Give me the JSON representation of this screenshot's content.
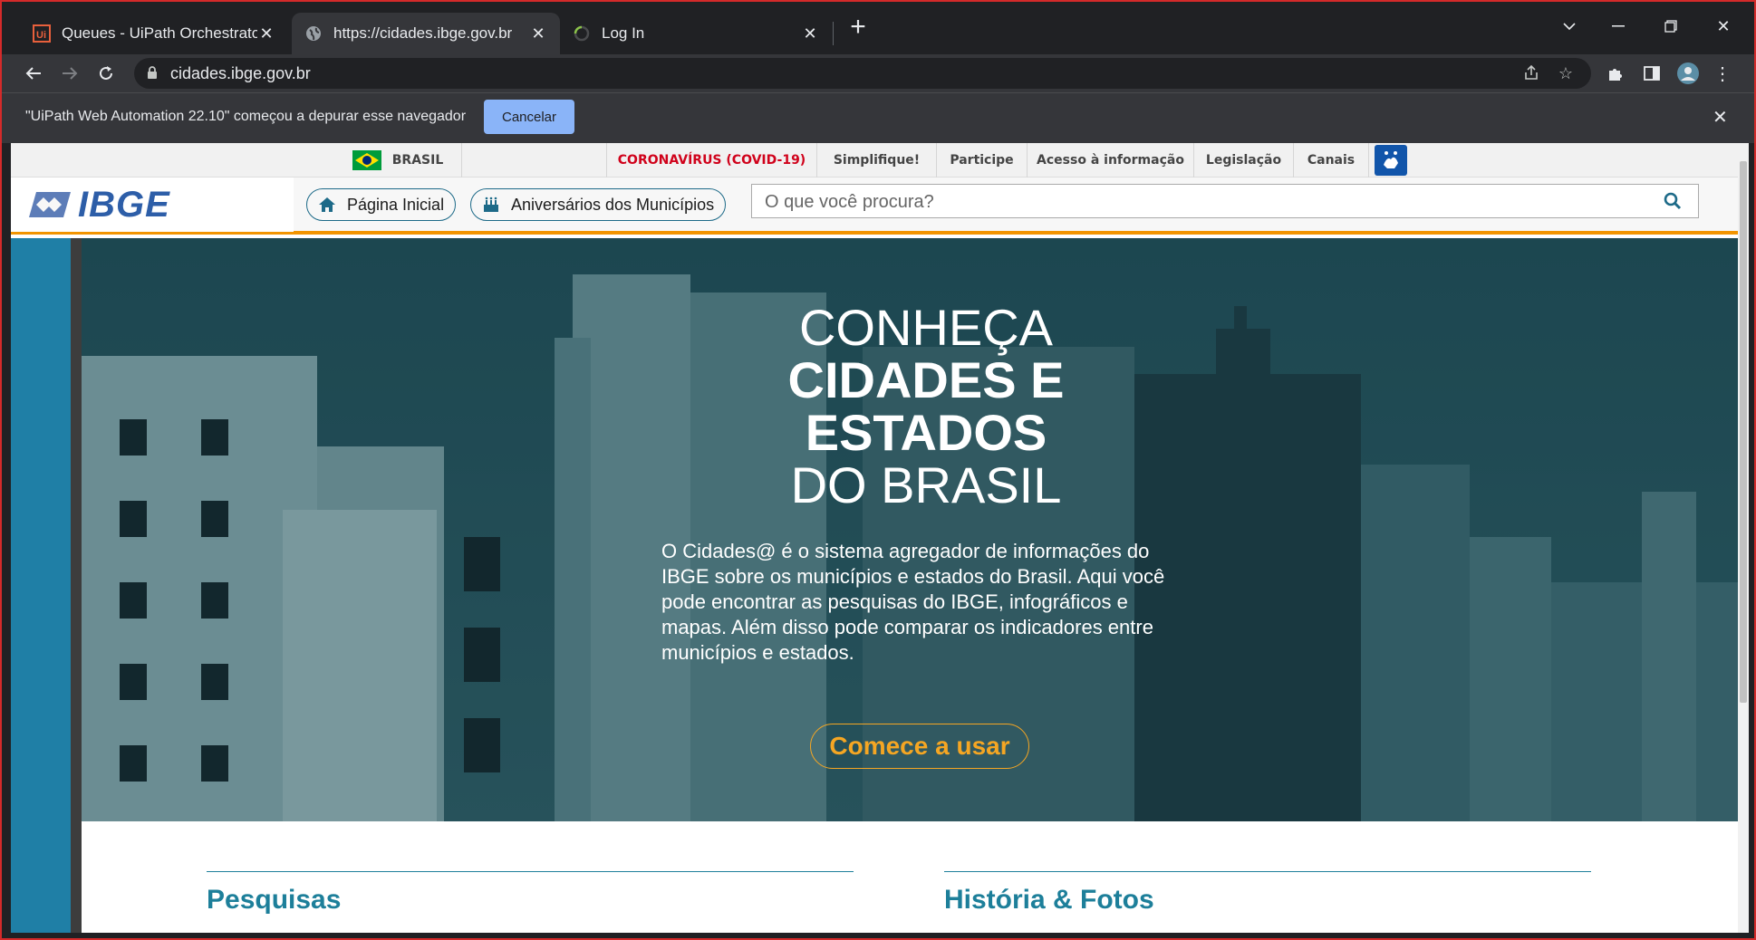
{
  "browser": {
    "tabs": [
      {
        "title": "Queues - UiPath Orchestrator",
        "icon": "uipath-icon"
      },
      {
        "title": "https://cidades.ibge.gov.br",
        "icon": "globe-icon"
      },
      {
        "title": "Log In",
        "icon": "loading-icon"
      }
    ],
    "url": "cidades.ibge.gov.br",
    "infobar": {
      "message": "\"UiPath Web Automation 22.10\" começou a depurar esse navegador",
      "cancel_label": "Cancelar"
    }
  },
  "govbar": {
    "country": "BRASIL",
    "links": [
      "CORONAVÍRUS (COVID-19)",
      "Simplifique!",
      "Participe",
      "Acesso à informação",
      "Legislação",
      "Canais"
    ]
  },
  "ibge": {
    "logo": "IBGE",
    "home_label": "Página Inicial",
    "birthdays_label": "Aniversários dos Municípios",
    "search_placeholder": "O que você procura?"
  },
  "hero": {
    "line1": "CONHEÇA",
    "line2": "CIDADES E",
    "line3": "ESTADOS",
    "line4": "DO BRASIL",
    "description": "O Cidades@ é o sistema agregador de informações do IBGE sobre os municípios e estados do Brasil. Aqui você pode encontrar as pesquisas do IBGE, infográficos e mapas. Além disso pode comparar os indicadores entre municípios e estados.",
    "cta": "Comece a usar"
  },
  "sections": [
    "Pesquisas",
    "História & Fotos"
  ],
  "colors": {
    "accent_orange": "#f29400",
    "ibge_blue": "#2d5ea8",
    "teal": "#1d7f9a",
    "covid_red": "#d0021b",
    "cta_orange": "#f5a623"
  }
}
